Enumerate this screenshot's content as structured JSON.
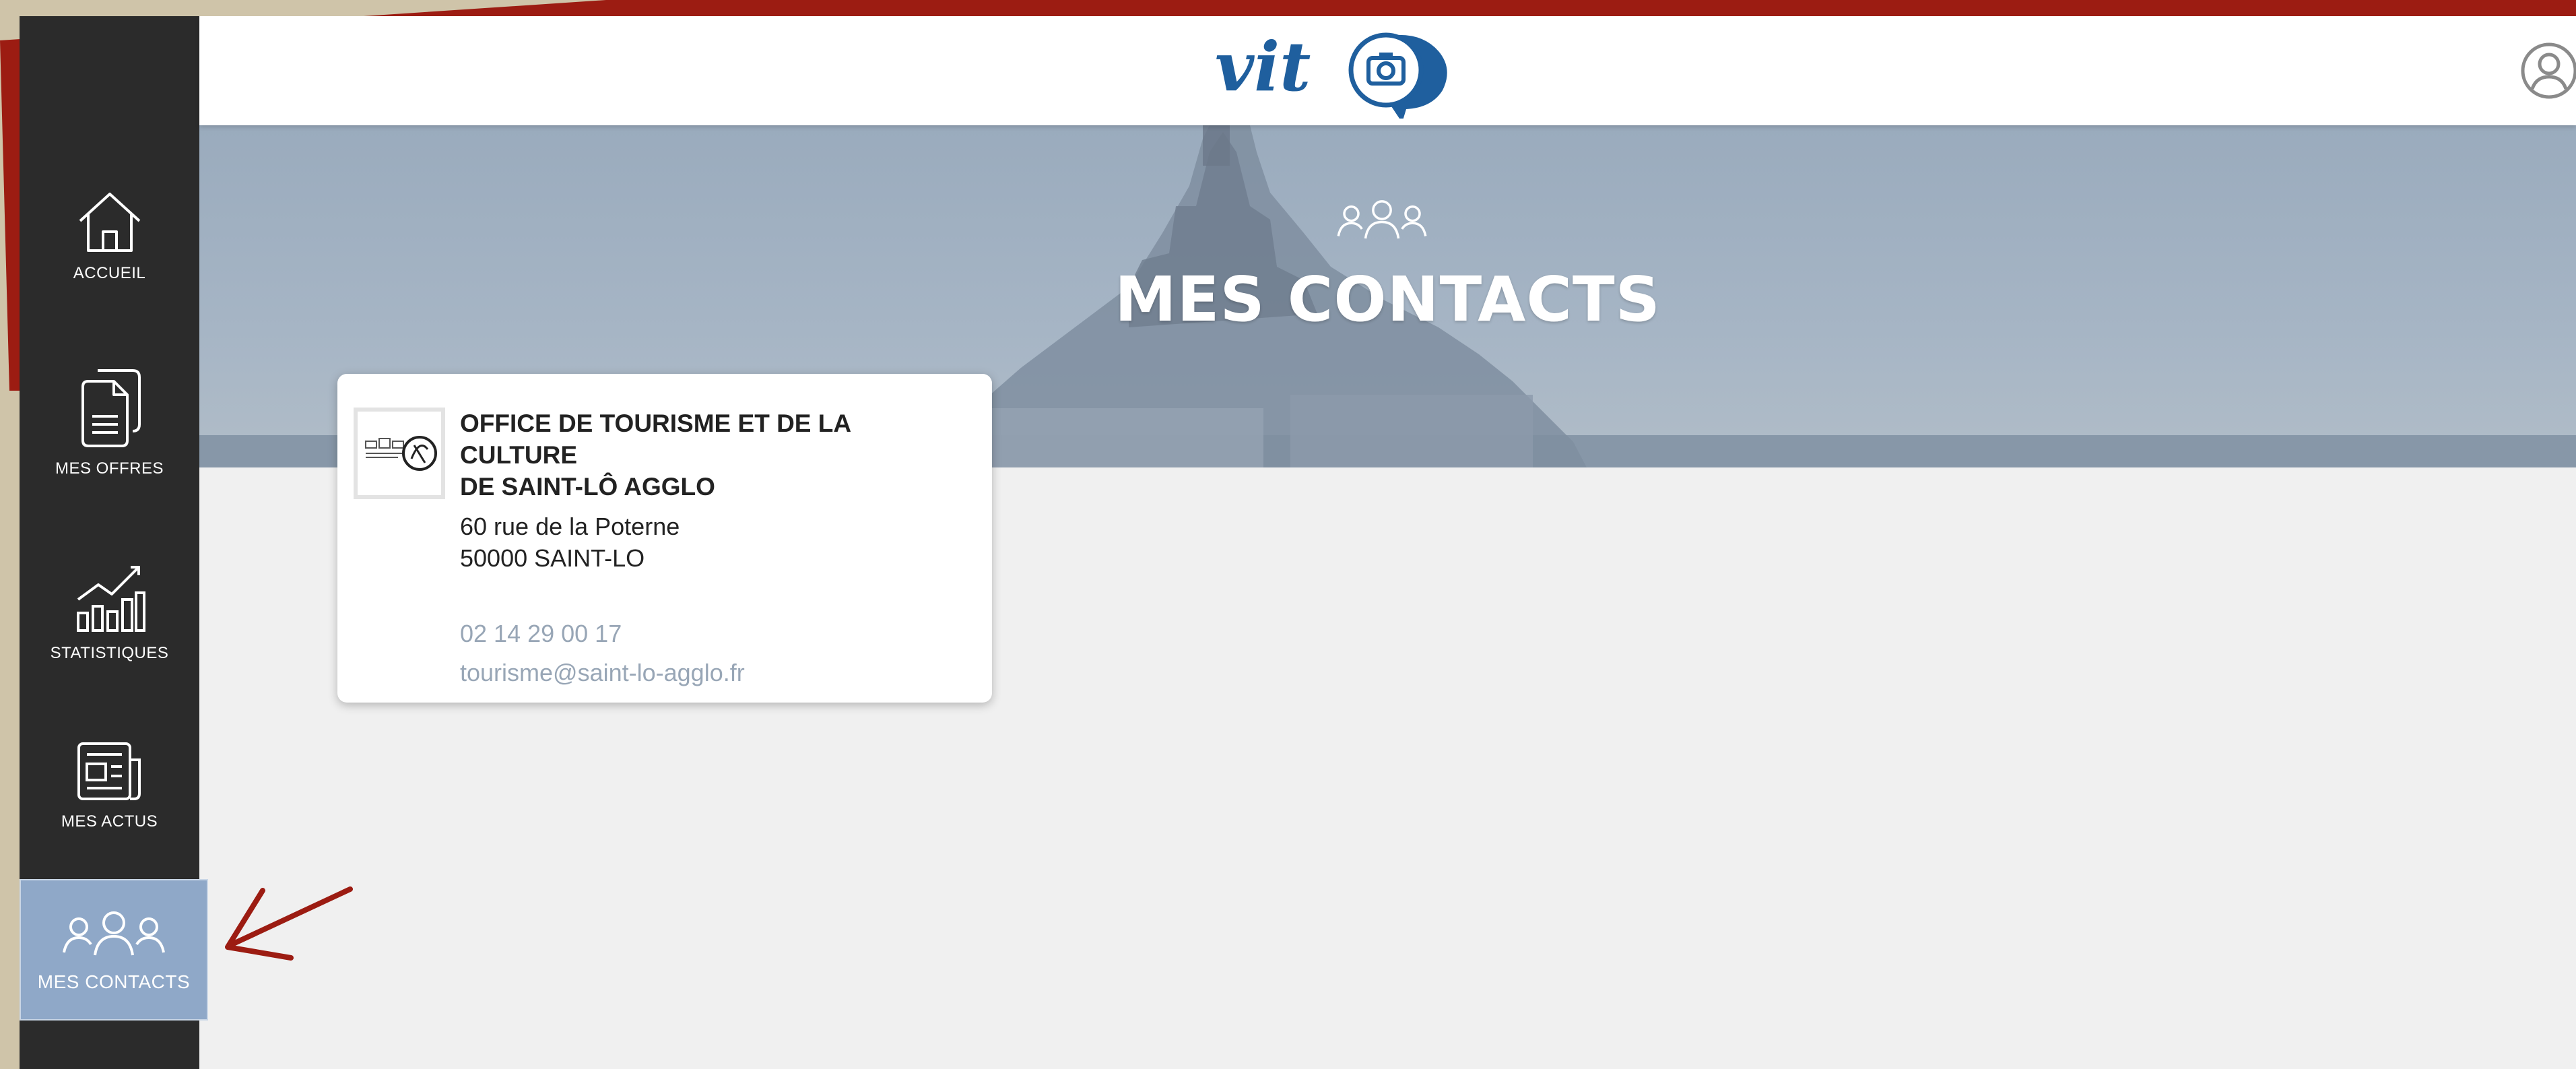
{
  "colors": {
    "sidebar": "#2b2b2b",
    "active_nav": "#8fa8c8",
    "header": "#ffffff",
    "content_bg": "#f0f0f0",
    "link": "#98a6b6",
    "logo_blue": "#1f5f9e",
    "annotation_red": "#9c1c12"
  },
  "header": {
    "logo_text": "vit",
    "user_icon": "user-circle-icon"
  },
  "sidebar": {
    "items": [
      {
        "label": "ACCUEIL",
        "icon": "home-icon",
        "active": false
      },
      {
        "label": "MES OFFRES",
        "icon": "documents-icon",
        "active": false
      },
      {
        "label": "STATISTIQUES",
        "icon": "bar-chart-icon",
        "active": false
      },
      {
        "label": "MES ACTUS",
        "icon": "newspaper-icon",
        "active": false
      },
      {
        "label": "MES CONTACTS",
        "icon": "contacts-icon",
        "active": true
      }
    ]
  },
  "hero": {
    "icon": "contacts-icon",
    "title": "MES CONTACTS"
  },
  "contact_card": {
    "logo_icon": "organization-logo",
    "name_line1": "OFFICE DE TOURISME ET DE LA CULTURE",
    "name_line2": "DE SAINT-LÔ AGGLO",
    "address_line1": "60 rue de la Poterne",
    "address_line2": "50000 SAINT-LO",
    "phone": "02 14 29 00 17",
    "email": "tourisme@saint-lo-agglo.fr"
  },
  "annotation": {
    "icon": "red-arrow-icon"
  }
}
